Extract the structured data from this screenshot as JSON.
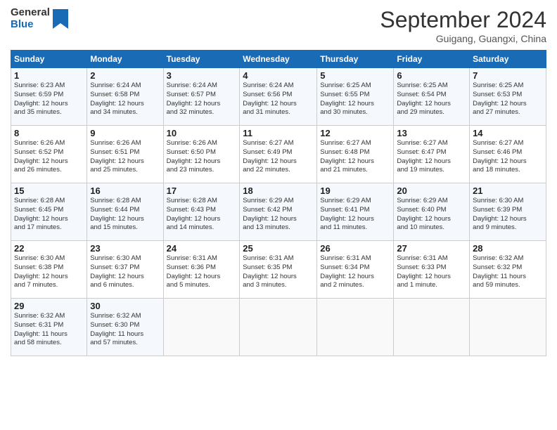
{
  "header": {
    "logo_text_general": "General",
    "logo_text_blue": "Blue",
    "month_title": "September 2024",
    "subtitle": "Guigang, Guangxi, China"
  },
  "weekdays": [
    "Sunday",
    "Monday",
    "Tuesday",
    "Wednesday",
    "Thursday",
    "Friday",
    "Saturday"
  ],
  "weeks": [
    [
      {
        "day": "1",
        "info": "Sunrise: 6:23 AM\nSunset: 6:59 PM\nDaylight: 12 hours\nand 35 minutes."
      },
      {
        "day": "2",
        "info": "Sunrise: 6:24 AM\nSunset: 6:58 PM\nDaylight: 12 hours\nand 34 minutes."
      },
      {
        "day": "3",
        "info": "Sunrise: 6:24 AM\nSunset: 6:57 PM\nDaylight: 12 hours\nand 32 minutes."
      },
      {
        "day": "4",
        "info": "Sunrise: 6:24 AM\nSunset: 6:56 PM\nDaylight: 12 hours\nand 31 minutes."
      },
      {
        "day": "5",
        "info": "Sunrise: 6:25 AM\nSunset: 6:55 PM\nDaylight: 12 hours\nand 30 minutes."
      },
      {
        "day": "6",
        "info": "Sunrise: 6:25 AM\nSunset: 6:54 PM\nDaylight: 12 hours\nand 29 minutes."
      },
      {
        "day": "7",
        "info": "Sunrise: 6:25 AM\nSunset: 6:53 PM\nDaylight: 12 hours\nand 27 minutes."
      }
    ],
    [
      {
        "day": "8",
        "info": "Sunrise: 6:26 AM\nSunset: 6:52 PM\nDaylight: 12 hours\nand 26 minutes."
      },
      {
        "day": "9",
        "info": "Sunrise: 6:26 AM\nSunset: 6:51 PM\nDaylight: 12 hours\nand 25 minutes."
      },
      {
        "day": "10",
        "info": "Sunrise: 6:26 AM\nSunset: 6:50 PM\nDaylight: 12 hours\nand 23 minutes."
      },
      {
        "day": "11",
        "info": "Sunrise: 6:27 AM\nSunset: 6:49 PM\nDaylight: 12 hours\nand 22 minutes."
      },
      {
        "day": "12",
        "info": "Sunrise: 6:27 AM\nSunset: 6:48 PM\nDaylight: 12 hours\nand 21 minutes."
      },
      {
        "day": "13",
        "info": "Sunrise: 6:27 AM\nSunset: 6:47 PM\nDaylight: 12 hours\nand 19 minutes."
      },
      {
        "day": "14",
        "info": "Sunrise: 6:27 AM\nSunset: 6:46 PM\nDaylight: 12 hours\nand 18 minutes."
      }
    ],
    [
      {
        "day": "15",
        "info": "Sunrise: 6:28 AM\nSunset: 6:45 PM\nDaylight: 12 hours\nand 17 minutes."
      },
      {
        "day": "16",
        "info": "Sunrise: 6:28 AM\nSunset: 6:44 PM\nDaylight: 12 hours\nand 15 minutes."
      },
      {
        "day": "17",
        "info": "Sunrise: 6:28 AM\nSunset: 6:43 PM\nDaylight: 12 hours\nand 14 minutes."
      },
      {
        "day": "18",
        "info": "Sunrise: 6:29 AM\nSunset: 6:42 PM\nDaylight: 12 hours\nand 13 minutes."
      },
      {
        "day": "19",
        "info": "Sunrise: 6:29 AM\nSunset: 6:41 PM\nDaylight: 12 hours\nand 11 minutes."
      },
      {
        "day": "20",
        "info": "Sunrise: 6:29 AM\nSunset: 6:40 PM\nDaylight: 12 hours\nand 10 minutes."
      },
      {
        "day": "21",
        "info": "Sunrise: 6:30 AM\nSunset: 6:39 PM\nDaylight: 12 hours\nand 9 minutes."
      }
    ],
    [
      {
        "day": "22",
        "info": "Sunrise: 6:30 AM\nSunset: 6:38 PM\nDaylight: 12 hours\nand 7 minutes."
      },
      {
        "day": "23",
        "info": "Sunrise: 6:30 AM\nSunset: 6:37 PM\nDaylight: 12 hours\nand 6 minutes."
      },
      {
        "day": "24",
        "info": "Sunrise: 6:31 AM\nSunset: 6:36 PM\nDaylight: 12 hours\nand 5 minutes."
      },
      {
        "day": "25",
        "info": "Sunrise: 6:31 AM\nSunset: 6:35 PM\nDaylight: 12 hours\nand 3 minutes."
      },
      {
        "day": "26",
        "info": "Sunrise: 6:31 AM\nSunset: 6:34 PM\nDaylight: 12 hours\nand 2 minutes."
      },
      {
        "day": "27",
        "info": "Sunrise: 6:31 AM\nSunset: 6:33 PM\nDaylight: 12 hours\nand 1 minute."
      },
      {
        "day": "28",
        "info": "Sunrise: 6:32 AM\nSunset: 6:32 PM\nDaylight: 11 hours\nand 59 minutes."
      }
    ],
    [
      {
        "day": "29",
        "info": "Sunrise: 6:32 AM\nSunset: 6:31 PM\nDaylight: 11 hours\nand 58 minutes."
      },
      {
        "day": "30",
        "info": "Sunrise: 6:32 AM\nSunset: 6:30 PM\nDaylight: 11 hours\nand 57 minutes."
      },
      {
        "day": "",
        "info": ""
      },
      {
        "day": "",
        "info": ""
      },
      {
        "day": "",
        "info": ""
      },
      {
        "day": "",
        "info": ""
      },
      {
        "day": "",
        "info": ""
      }
    ]
  ]
}
